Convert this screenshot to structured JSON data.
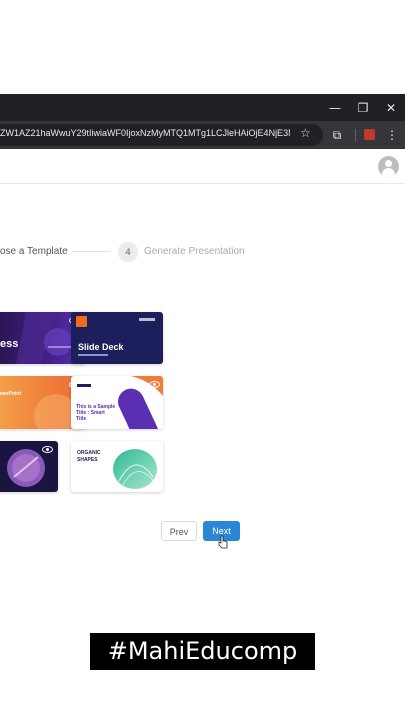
{
  "browser": {
    "url": "ZW1AZ21haWwuY29tIiwiaWF0IjoxNzMyMTQ1MTg1LCJleHAiOjE4NjE3NDU..."
  },
  "steps": {
    "step3_label": "ose a Template",
    "step4_number": "4",
    "step4_label": "Generate Presentation"
  },
  "templates": [
    {
      "title": "ess",
      "theme": "dark-purple"
    },
    {
      "title": "Slide Deck",
      "theme": "navy"
    },
    {
      "title": "werPoint",
      "theme": "orange"
    },
    {
      "title": "This is a Sample Title : Smart Title",
      "theme": "white-purple"
    },
    {
      "title": "",
      "theme": "dark-navy-circle"
    },
    {
      "title": "ORGANIC SHAPES",
      "theme": "white-green"
    }
  ],
  "buttons": {
    "prev": "Prev",
    "next": "Next"
  },
  "watermark": "#MahiEducomp",
  "colors": {
    "chrome_dark": "#202124",
    "next_button": "#2a87d5"
  }
}
